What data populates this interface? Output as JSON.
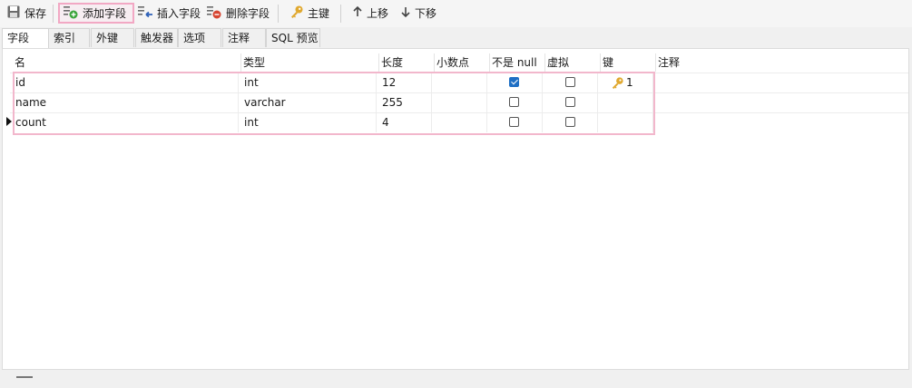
{
  "toolbar": {
    "save": "保存",
    "add_field": "添加字段",
    "insert_field": "插入字段",
    "delete_field": "删除字段",
    "primary_key": "主键",
    "move_up": "上移",
    "move_down": "下移"
  },
  "tabs": [
    "字段",
    "索引",
    "外键",
    "触发器",
    "选项",
    "注释",
    "SQL 预览"
  ],
  "columns": {
    "name": "名",
    "type": "类型",
    "length": "长度",
    "decimals": "小数点",
    "not_null": "不是 null",
    "virtual": "虚拟",
    "key": "键",
    "comment": "注释"
  },
  "rows": [
    {
      "name": "id",
      "type": "int",
      "length": "12",
      "decimals": "",
      "not_null": true,
      "virtual": false,
      "key": "1",
      "comment": ""
    },
    {
      "name": "name",
      "type": "varchar",
      "length": "255",
      "decimals": "",
      "not_null": false,
      "virtual": false,
      "key": "",
      "comment": ""
    },
    {
      "name": "count",
      "type": "int",
      "length": "4",
      "decimals": "",
      "not_null": false,
      "virtual": false,
      "key": "",
      "comment": ""
    }
  ],
  "colors": {
    "highlight_border": "#f2a8c4",
    "checkbox_checked": "#1f6fc4",
    "key_gold": "#e0a82e"
  }
}
